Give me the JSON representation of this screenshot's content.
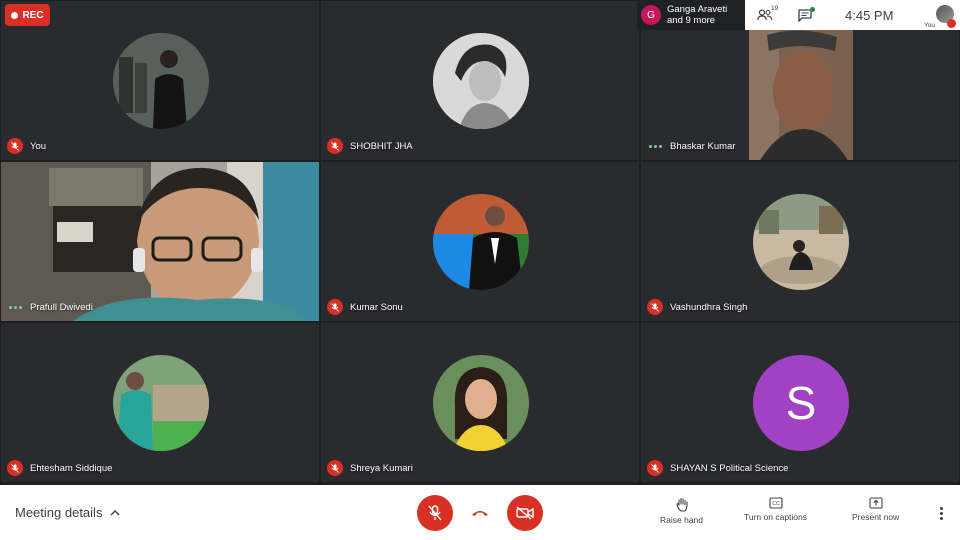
{
  "recording": {
    "label": "REC"
  },
  "presenter": {
    "initial": "G",
    "line1": "Ganga Araveti",
    "line2": "and 9 more"
  },
  "infobar": {
    "people_count": "19",
    "time": "4:45 PM",
    "self_label": "You"
  },
  "tiles": [
    {
      "name": "You",
      "status": "muted"
    },
    {
      "name": "SHOBHIT JHA",
      "status": "muted"
    },
    {
      "name": "Bhaskar Kumar",
      "status": "speaking"
    },
    {
      "name": "Prafull Dwivedi",
      "status": "speaking"
    },
    {
      "name": "Kumar Sonu",
      "status": "muted"
    },
    {
      "name": "Vashundhra Singh",
      "status": "muted"
    },
    {
      "name": "Ehtesham Siddique",
      "status": "muted"
    },
    {
      "name": "Shreya Kumari",
      "status": "muted"
    },
    {
      "name": "SHAYAN S Political Science",
      "status": "muted",
      "initial": "S",
      "avatar_color": "#a142c4"
    }
  ],
  "bottom": {
    "meeting_details": "Meeting details",
    "raise_hand": "Raise hand",
    "captions": "Turn on captions",
    "present": "Present now"
  },
  "colors": {
    "red": "#d93025",
    "background": "#202124",
    "speaking_dots": "#81c995"
  }
}
